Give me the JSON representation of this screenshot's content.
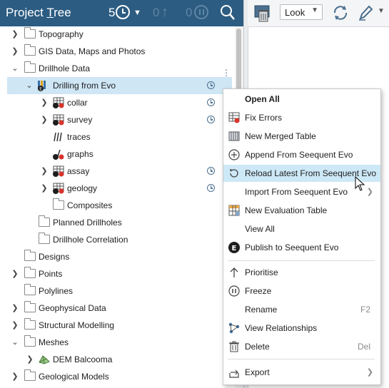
{
  "header": {
    "title_pre": "Project ",
    "title_u": "T",
    "title_post": "ree",
    "history_count": "5",
    "redo_count": "0",
    "queue_count": "0",
    "icons": [
      "clock-icon",
      "chevron-down-icon",
      "up-arrow-icon",
      "pause-icon",
      "search-icon"
    ]
  },
  "toolbar": {
    "look_label": "Look",
    "icons": [
      "trash-view-icon",
      "rotate-view-icon",
      "draw-pen-icon"
    ]
  },
  "tree": {
    "items": [
      {
        "label": "Topography",
        "depth": 0,
        "chevron": "right"
      },
      {
        "label": "GIS Data, Maps and Photos",
        "depth": 0,
        "chevron": "right"
      },
      {
        "label": "Drillhole Data",
        "depth": 0,
        "chevron": "down"
      },
      {
        "label": "Drilling from Evo",
        "depth": 1,
        "chevron": "down",
        "selected": true
      },
      {
        "label": "collar",
        "depth": 2,
        "chevron": "right"
      },
      {
        "label": "survey",
        "depth": 2,
        "chevron": "right"
      },
      {
        "label": "traces",
        "depth": 2,
        "chevron": ""
      },
      {
        "label": "graphs",
        "depth": 2,
        "chevron": ""
      },
      {
        "label": "assay",
        "depth": 2,
        "chevron": "right"
      },
      {
        "label": "geology",
        "depth": 2,
        "chevron": "right"
      },
      {
        "label": "Composites",
        "depth": 2,
        "chevron": ""
      },
      {
        "label": "Planned Drillholes",
        "depth": 1,
        "chevron": ""
      },
      {
        "label": "Drillhole Correlation",
        "depth": 1,
        "chevron": ""
      },
      {
        "label": "Designs",
        "depth": 0,
        "chevron": ""
      },
      {
        "label": "Points",
        "depth": 0,
        "chevron": "right"
      },
      {
        "label": "Polylines",
        "depth": 0,
        "chevron": ""
      },
      {
        "label": "Geophysical Data",
        "depth": 0,
        "chevron": "right"
      },
      {
        "label": "Structural Modelling",
        "depth": 0,
        "chevron": "right"
      },
      {
        "label": "Meshes",
        "depth": 0,
        "chevron": "down"
      },
      {
        "label": "DEM Balcooma",
        "depth": 1,
        "chevron": "right"
      },
      {
        "label": "Geological Models",
        "depth": 0,
        "chevron": "right"
      }
    ]
  },
  "context_menu": {
    "items": [
      {
        "label": "Open All",
        "bold": true
      },
      {
        "label": "Fix Errors"
      },
      {
        "label": "New Merged Table"
      },
      {
        "label": "Append From Seequent Evo"
      },
      {
        "label": "Reload Latest From Seequent Evo",
        "highlighted": true
      },
      {
        "label": "Import From Seequent Evo",
        "submenu": true
      },
      {
        "label": "New Evaluation Table"
      },
      {
        "label": "View All"
      },
      {
        "label": "Publish to Seequent Evo"
      },
      {
        "label": "Prioritise"
      },
      {
        "label": "Freeze"
      },
      {
        "label": "Rename",
        "shortcut": "F2"
      },
      {
        "label": "View Relationships"
      },
      {
        "label": "Delete",
        "shortcut": "Del"
      },
      {
        "label": "Export",
        "submenu": true
      }
    ]
  },
  "colors": {
    "header_bg": "#2c5c82",
    "selection": "#cfe6f5",
    "menu_highlight": "#cde8f7",
    "error_red": "#d9332b",
    "evo_dark": "#1e1e1e"
  }
}
